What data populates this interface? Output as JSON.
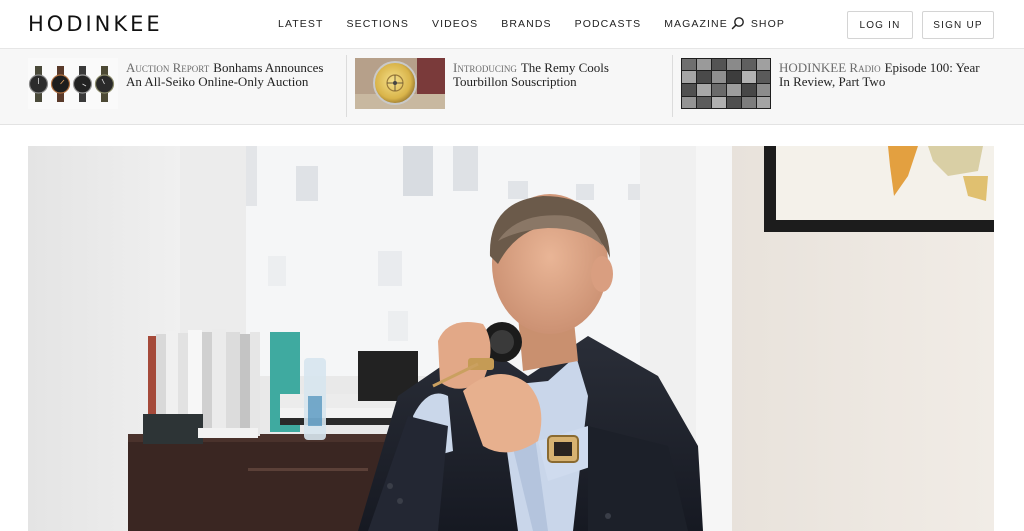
{
  "header": {
    "logo": "HODINKEE",
    "nav": [
      "LATEST",
      "SECTIONS",
      "VIDEOS",
      "BRANDS",
      "PODCASTS",
      "MAGAZINE",
      "SHOP"
    ],
    "search_icon": "search-icon",
    "login_label": "LOG IN",
    "signup_label": "SIGN UP"
  },
  "stories": [
    {
      "kicker": "Auction Report",
      "title": "Bonhams Announces An All-Seiko Online-Only Auction",
      "thumb": "four-watches-thumbnail"
    },
    {
      "kicker": "Introducing",
      "title": "The Remy Cools Tourbillon Souscription",
      "thumb": "gold-tourbillon-thumbnail"
    },
    {
      "kicker": "HODINKEE Radio",
      "title": "Episode 100: Year In Review, Part Two",
      "thumb": "podcast-grid-thumbnail"
    }
  ],
  "hero": {
    "image": "man-with-loupe-examining-watch-photo"
  },
  "colors": {
    "text": "#1a1a1a",
    "kicker": "#6b6b6b",
    "strip_bg": "#f7f7f7",
    "border": "#e6e6e6"
  }
}
